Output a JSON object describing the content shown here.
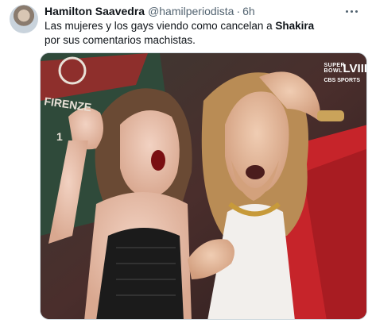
{
  "author": {
    "name": "Hamilton Saavedra",
    "handle": "@hamilperiodista",
    "separator": "·",
    "time": "6h"
  },
  "tweet": {
    "text_before": "Las mujeres y los gays viendo como cancelan a ",
    "text_bold": "Shakira",
    "text_after": " por sus comentarios machistas."
  },
  "media": {
    "shirt_text": "FIRENZE",
    "shirt_number": "1",
    "broadcast": {
      "line1": "SUPER",
      "line2": "BOWL",
      "numeral": "LVIII",
      "network": "CBS SPORTS"
    }
  },
  "icons": {
    "more": "more-horizontal-icon",
    "avatar": "avatar"
  },
  "colors": {
    "text": "#0f1419",
    "secondary": "#536471",
    "border": "#cfd9de",
    "red_jacket": "#c6242a",
    "black_top": "#1b1b1b",
    "white_top": "#f2efec"
  }
}
